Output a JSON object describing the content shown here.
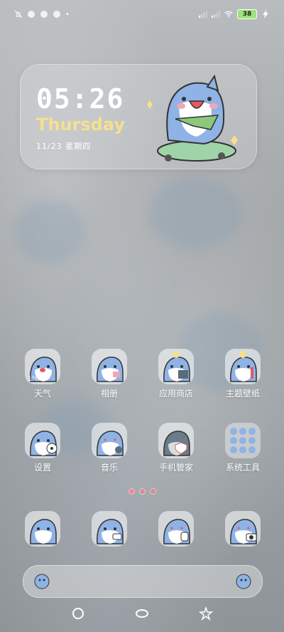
{
  "status_bar": {
    "left_icons": [
      "notifications-muted-icon",
      "shark-notif-icon",
      "shark-notif-icon",
      "shark-notif-icon",
      "dot-icon"
    ],
    "right_icons": [
      "signal-1-icon",
      "signal-2-icon",
      "wifi-icon"
    ],
    "battery": "38",
    "charging": true
  },
  "widget": {
    "time": "05:26",
    "day": "Thursday",
    "date": "11/23 星期四"
  },
  "apps": [
    {
      "name": "weather",
      "label": "天气",
      "overlay": "1°C"
    },
    {
      "name": "gallery",
      "label": "相册"
    },
    {
      "name": "app-store",
      "label": "应用商店"
    },
    {
      "name": "theme-wallpaper",
      "label": "主题壁纸"
    },
    {
      "name": "settings",
      "label": "设置"
    },
    {
      "name": "music",
      "label": "音乐"
    },
    {
      "name": "phone-manager",
      "label": "手机管家"
    },
    {
      "name": "system-tools",
      "label": "系统工具"
    }
  ],
  "pages": {
    "count": 3,
    "active": 0
  },
  "dock": [
    {
      "name": "phone"
    },
    {
      "name": "messages"
    },
    {
      "name": "browser"
    },
    {
      "name": "camera"
    }
  ],
  "colors": {
    "accent": "#f6e08e",
    "shark": "#8fb3e6",
    "blush": "#f2a7b5"
  }
}
